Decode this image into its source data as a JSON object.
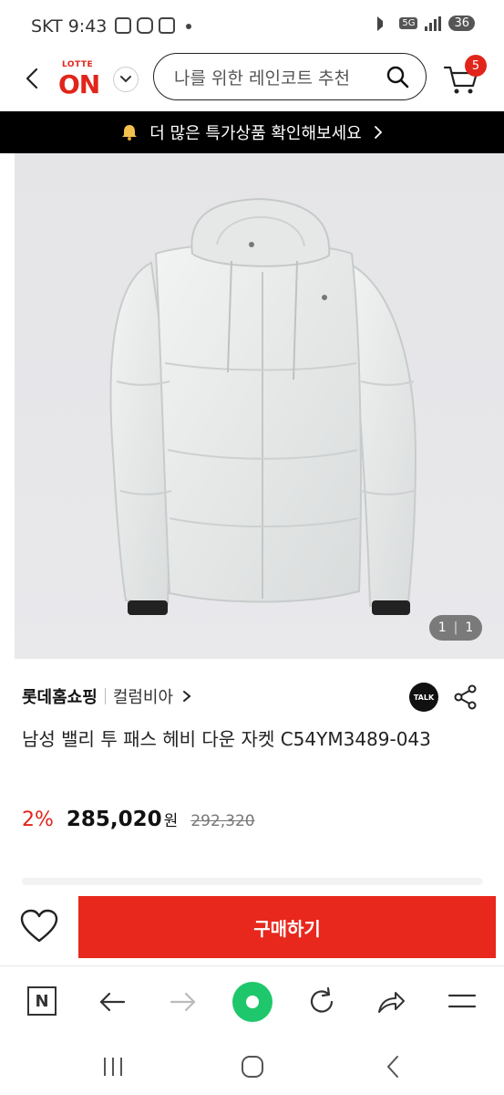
{
  "status_bar": {
    "carrier": "SKT",
    "time": "9:43",
    "network": "5G",
    "battery": "36"
  },
  "header": {
    "logo_top": "LOTTE",
    "logo_main": "ON",
    "search_placeholder": "나를 위한 레인코트 추천",
    "cart_count": "5"
  },
  "promo": {
    "text": "더 많은 특가상품 확인해보세요"
  },
  "product": {
    "image_index": "1",
    "image_total": "1",
    "seller": "롯데홈쇼핑",
    "brand": "컬럼비아",
    "talk_label": "TALK",
    "title": "남성 밸리 투 패스 헤비 다운 자켓 C54YM3489-043",
    "discount": "2%",
    "price": "285,020",
    "currency": "원",
    "original_price": "292,320"
  },
  "purchase": {
    "buy_label": "구매하기"
  },
  "browser_toolbar": {
    "n_label": "N"
  },
  "colors": {
    "brand_red": "#e1251b",
    "buy_button": "#e8271d",
    "home_green": "#1ec76b",
    "banner_black": "#000000"
  }
}
